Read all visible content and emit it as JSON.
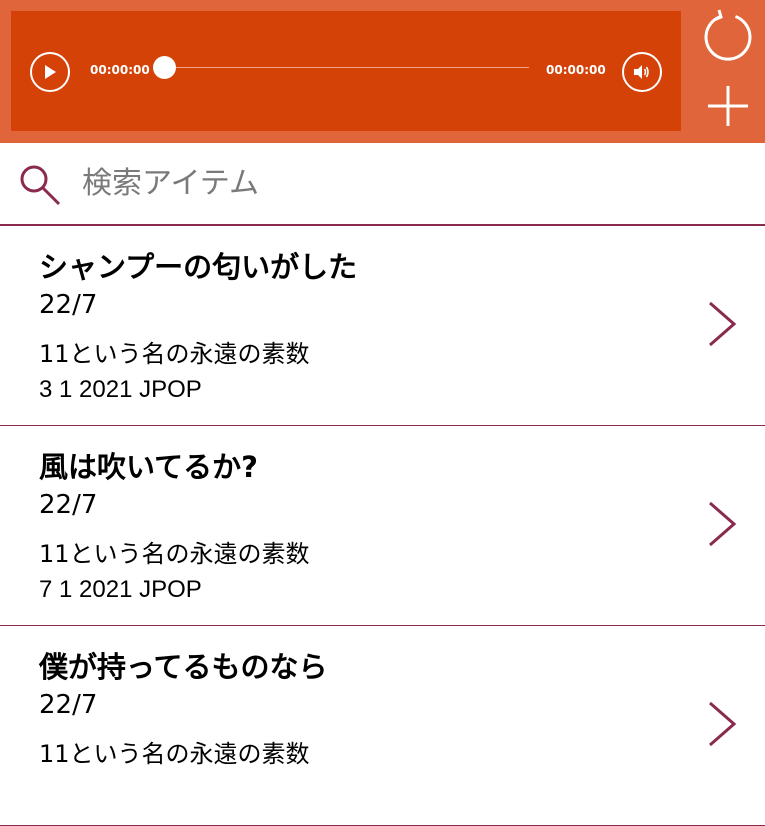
{
  "player": {
    "current_time": "00:00:00",
    "total_time": "00:00:00",
    "progress": 0,
    "play_icon": "play-icon",
    "volume_icon": "volume-icon"
  },
  "actions": {
    "refresh_icon": "refresh-icon",
    "add_icon": "add-icon"
  },
  "search": {
    "placeholder": "検索アイテム",
    "value": ""
  },
  "songs": [
    {
      "title": "シャンプーの匂いがした",
      "artist": "22/7",
      "album": "11という名の永遠の素数",
      "meta": "3 1 2021 JPOP"
    },
    {
      "title": "風は吹いてるか?",
      "artist": "22/7",
      "album": "11という名の永遠の素数",
      "meta": "7 1 2021 JPOP"
    },
    {
      "title": "僕が持ってるものなら",
      "artist": "22/7",
      "album": "11という名の永遠の素数",
      "meta": ""
    }
  ],
  "colors": {
    "header_bg": "#e0653a",
    "player_bg": "#d44208",
    "accent": "#8a2a4e"
  }
}
